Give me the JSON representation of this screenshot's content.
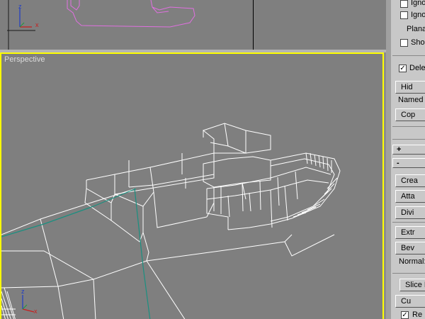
{
  "viewports": {
    "top": {
      "axis_z": "z",
      "axis_x": "x"
    },
    "perspective": {
      "label": "Perspective",
      "axis_z": "z",
      "axis_x": "x"
    }
  },
  "panel": {
    "ignore1": "Igno",
    "ignore2": "Igno",
    "planar": "Plana",
    "show": "Sho",
    "delete": "Dele",
    "hide": "Hid",
    "named": "Named",
    "copy": "Cop",
    "rollout_plus": "+",
    "rollout_minus": "-",
    "create": "Crea",
    "attach": "Atta",
    "divide": "Divi",
    "extrude": "Extr",
    "bevel": "Bev",
    "normal": "Normal:",
    "slice": "Slice F",
    "cut": "Cu",
    "refine": "Re"
  },
  "colors": {
    "wire": "#ffffff",
    "selected_viewport_border": "#ffff00",
    "viewport_bg": "#7f7f7f",
    "spline_top": "#e070e0",
    "edge_green": "#1a9080"
  }
}
